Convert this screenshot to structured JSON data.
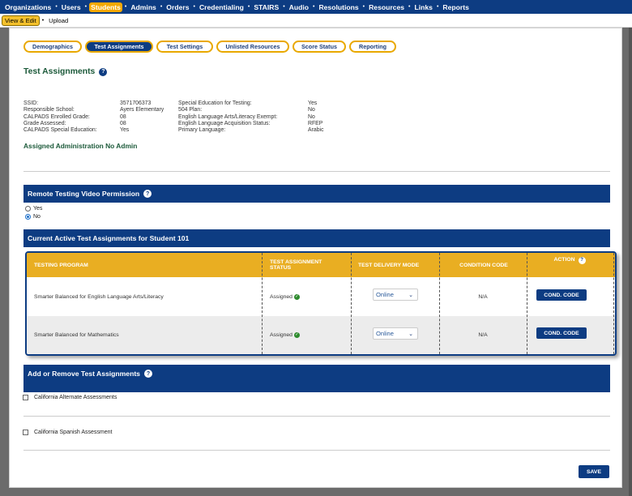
{
  "topnav": {
    "items": [
      "Organizations",
      "Users",
      "Students",
      "Admins",
      "Orders",
      "Credentialing",
      "STAIRS",
      "Audio",
      "Resolutions",
      "Resources",
      "Links",
      "Reports"
    ],
    "active_index": 2
  },
  "subnav": {
    "items": [
      "View & Edit",
      "Upload"
    ],
    "active_index": 0
  },
  "tabs": [
    "Demographics",
    "Test Assignments",
    "Test Settings",
    "Unlisted Resources",
    "Score Status",
    "Reporting"
  ],
  "active_tab": 1,
  "page_title": "Test Assignments",
  "student_info": {
    "left": [
      {
        "label": "SSID:",
        "value": "3571706373"
      },
      {
        "label": "Responsible School:",
        "value": "Ayers Elementary"
      },
      {
        "label": "CALPADS Enrolled Grade:",
        "value": "08"
      },
      {
        "label": "Grade Assessed:",
        "value": "08"
      },
      {
        "label": "CALPADS Special Education:",
        "value": "Yes"
      }
    ],
    "right": [
      {
        "label": "Special Education for Testing:",
        "value": "Yes"
      },
      {
        "label": "504 Plan:",
        "value": "No"
      },
      {
        "label": "English Language Arts/Literacy Exempt:",
        "value": "No"
      },
      {
        "label": "English Language Acquisition Status:",
        "value": "RFEP"
      },
      {
        "label": "Primary Language:",
        "value": "Arabic"
      }
    ]
  },
  "assigned_admin": "Assigned Administration No Admin",
  "remote_section": {
    "title": "Remote Testing Video Permission",
    "options": [
      "Yes",
      "No"
    ],
    "selected": "No"
  },
  "current_section": {
    "title": "Current Active Test Assignments for Student 101"
  },
  "table": {
    "headers": [
      "TESTING PROGRAM",
      "TEST ASSIGNMENT STATUS",
      "TEST DELIVERY MODE",
      "CONDITION CODE",
      "ACTION"
    ],
    "rows": [
      {
        "program": "Smarter Balanced for English Language Arts/Literacy",
        "status": "Assigned",
        "mode": "Online",
        "condition": "N/A",
        "action": "COND. CODE"
      },
      {
        "program": "Smarter Balanced for Mathematics",
        "status": "Assigned",
        "mode": "Online",
        "condition": "N/A",
        "action": "COND. CODE"
      }
    ]
  },
  "add_remove_section": {
    "title": "Add or Remove Test Assignments",
    "items": [
      "California Alternate Assessments",
      "California Spanish Assessment"
    ]
  },
  "save_label": "SAVE",
  "icons": {
    "help": "question-circle-icon",
    "check": "check-circle-icon",
    "dropdown": "chevron-down-icon"
  },
  "colors": {
    "nav_blue": "#0d3c82",
    "accent_gold": "#e9ae22",
    "title_green": "#1c5a3a"
  }
}
